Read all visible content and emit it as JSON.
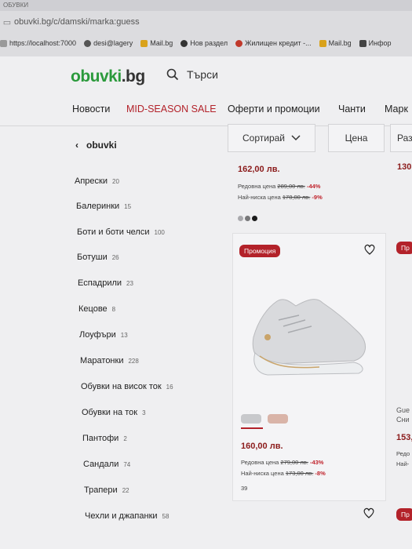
{
  "browser": {
    "tab_title": "ОБУВКИ",
    "url": "obuvki.bg/c/damski/marka:guess",
    "bookmarks": [
      "https://localhost:7000",
      "desi@lagery",
      "Mail.bg",
      "Нов раздел",
      "Жилищен кредит -...",
      "Mail.bg",
      "Инфор"
    ]
  },
  "header": {
    "logo_main": "obuvki",
    "logo_ext": ".bg",
    "search_placeholder": "Търси"
  },
  "nav": [
    "Новости",
    "MID-SEASON SALE",
    "Оферти и промоции",
    "Чанти",
    "Марк"
  ],
  "sidebar": {
    "back_label": "obuvki",
    "categories": [
      {
        "label": "Апрески",
        "count": "20"
      },
      {
        "label": "Балеринки",
        "count": "15"
      },
      {
        "label": "Боти и боти челси",
        "count": "100"
      },
      {
        "label": "Ботуши",
        "count": "26"
      },
      {
        "label": "Еспадрили",
        "count": "23"
      },
      {
        "label": "Кецове",
        "count": "8"
      },
      {
        "label": "Лоуфъри",
        "count": "13"
      },
      {
        "label": "Маратонки",
        "count": "228"
      },
      {
        "label": "Обувки на висок ток",
        "count": "16"
      },
      {
        "label": "Обувки на ток",
        "count": "3"
      },
      {
        "label": "Пантофи",
        "count": "2"
      },
      {
        "label": "Сандали",
        "count": "74"
      },
      {
        "label": "Трапери",
        "count": "22"
      },
      {
        "label": "Чехли и джапанки",
        "count": "58"
      }
    ]
  },
  "toolbar": {
    "sort_label": "Сортирай",
    "price_label": "Цена",
    "partial_label": "Раз"
  },
  "product_top": {
    "price": "162,00 лв.",
    "regular_label": "Редовна цена",
    "regular_price": "289,00 лв.",
    "regular_discount": "-44%",
    "lowest_label": "Най-ниска цена",
    "lowest_price": "178,00 лв.",
    "lowest_discount": "-9%",
    "colors": [
      "#a9a9ad",
      "#777779",
      "#1b1b1b"
    ]
  },
  "product_card": {
    "badge": "Промоция",
    "price": "160,00 лв.",
    "regular_label": "Редовна цена",
    "regular_price": "279,00 лв.",
    "regular_discount": "-43%",
    "lowest_label": "Най-ниска цена",
    "lowest_price": "173,00 лв.",
    "lowest_discount": "-8%",
    "size": "39"
  },
  "right_partial": {
    "price_top": "130",
    "badge": "Пр",
    "brand": "Gue",
    "name": "Сни",
    "price": "153,",
    "regular": "Редо",
    "lowest": "Най-",
    "badge2": "Пр"
  }
}
